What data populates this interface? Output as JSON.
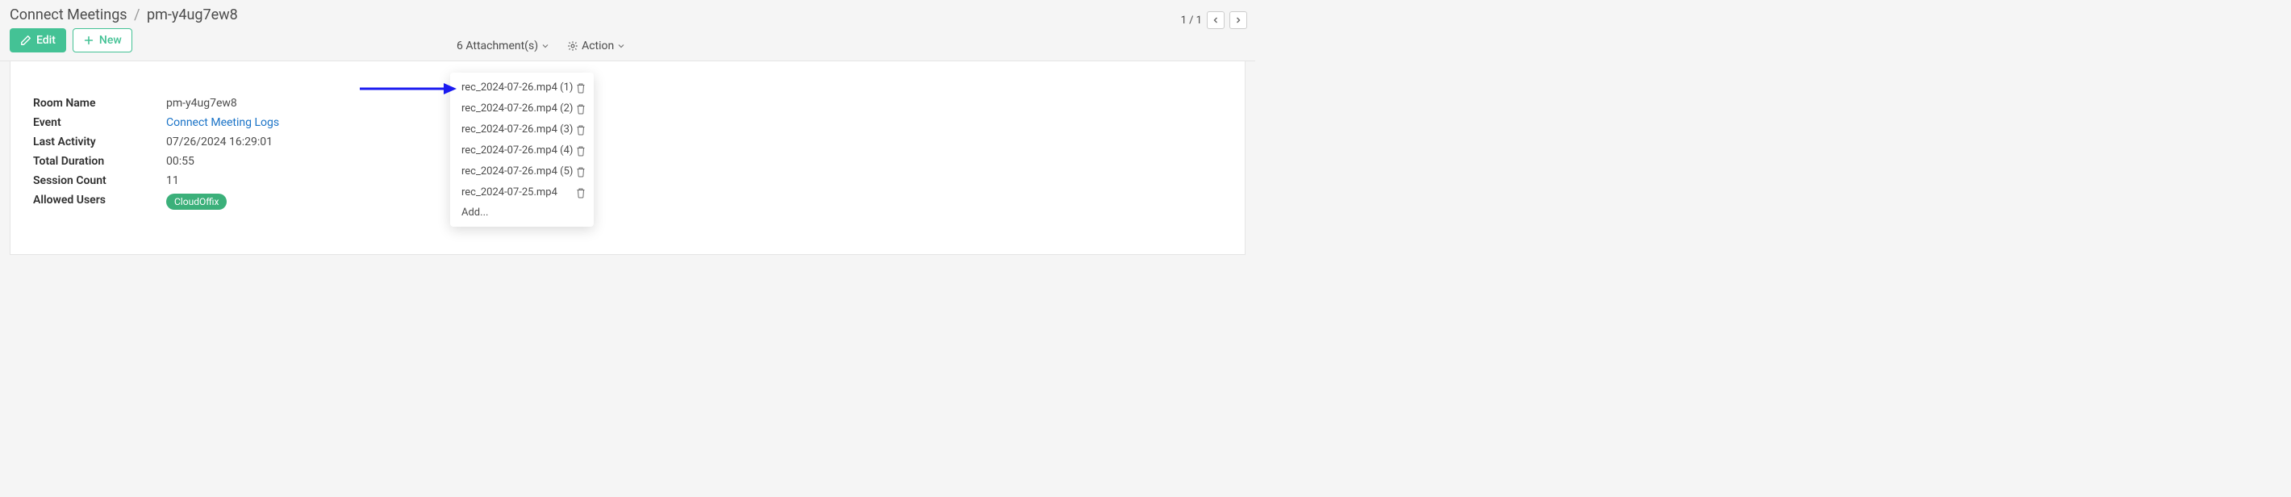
{
  "breadcrumb": {
    "root": "Connect Meetings",
    "current": "pm-y4ug7ew8"
  },
  "toolbar": {
    "edit_label": "Edit",
    "new_label": "New",
    "attachments_label": "6 Attachment(s)",
    "action_label": "Action"
  },
  "pager": {
    "text": "1 / 1"
  },
  "form": {
    "room_name_label": "Room Name",
    "room_name_value": "pm-y4ug7ew8",
    "event_label": "Event",
    "event_value": "Connect Meeting Logs",
    "last_activity_label": "Last Activity",
    "last_activity_value": "07/26/2024 16:29:01",
    "total_duration_label": "Total Duration",
    "total_duration_value": "00:55",
    "session_count_label": "Session Count",
    "session_count_value": "11",
    "allowed_users_label": "Allowed Users",
    "allowed_users_tag": "CloudOffix"
  },
  "attachments": {
    "items": [
      {
        "name": "rec_2024-07-26.mp4 (1)"
      },
      {
        "name": "rec_2024-07-26.mp4 (2)"
      },
      {
        "name": "rec_2024-07-26.mp4 (3)"
      },
      {
        "name": "rec_2024-07-26.mp4 (4)"
      },
      {
        "name": "rec_2024-07-26.mp4 (5)"
      },
      {
        "name": "rec_2024-07-25.mp4"
      }
    ],
    "add_label": "Add..."
  }
}
